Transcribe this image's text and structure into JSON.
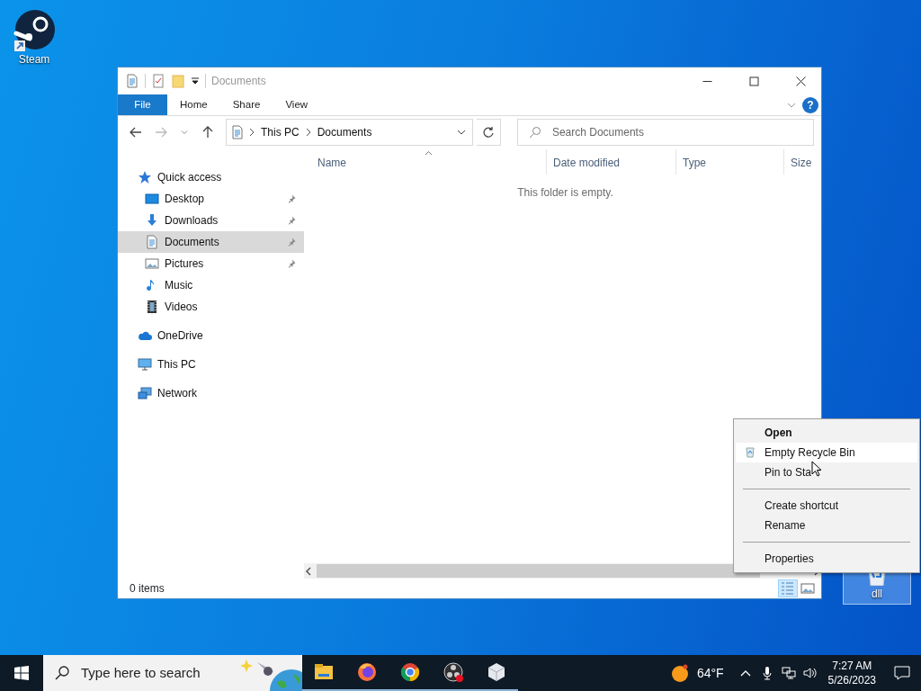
{
  "desktop_icons": [
    {
      "kind": "steam",
      "label": "Steam",
      "selected": false
    },
    {
      "kind": "recycle_bin",
      "label": "dll",
      "selected": true
    }
  ],
  "window": {
    "title": "Documents",
    "ribbon_tabs": [
      {
        "label": "File",
        "kind": "file"
      },
      {
        "label": "Home",
        "kind": "tab"
      },
      {
        "label": "Share",
        "kind": "tab"
      },
      {
        "label": "View",
        "kind": "tab"
      }
    ],
    "help_button": "?",
    "breadcrumbs": [
      "This PC",
      "Documents"
    ],
    "search": {
      "placeholder": "Search Documents"
    },
    "navigation": [
      {
        "label": "Quick access",
        "kind": "star",
        "selected": false,
        "children": [
          {
            "label": "Desktop",
            "kind": "desktop",
            "pinned": true,
            "selected": false
          },
          {
            "label": "Downloads",
            "kind": "download",
            "pinned": true,
            "selected": false
          },
          {
            "label": "Documents",
            "kind": "document",
            "pinned": true,
            "selected": true
          },
          {
            "label": "Pictures",
            "kind": "pictures",
            "pinned": true,
            "selected": false
          },
          {
            "label": "Music",
            "kind": "music",
            "pinned": false,
            "selected": false
          },
          {
            "label": "Videos",
            "kind": "videos",
            "pinned": false,
            "selected": false
          }
        ]
      },
      {
        "label": "OneDrive",
        "kind": "cloud",
        "selected": false
      },
      {
        "label": "This PC",
        "kind": "monitor",
        "selected": false
      },
      {
        "label": "Network",
        "kind": "network",
        "selected": false
      }
    ],
    "columns": [
      {
        "label": "Name",
        "sorted": true
      },
      {
        "label": "Date modified",
        "sorted": false
      },
      {
        "label": "Type",
        "sorted": false
      },
      {
        "label": "Size",
        "sorted": false
      }
    ],
    "empty_message": "This folder is empty.",
    "status_bar": {
      "item_count": "0 items",
      "view_buttons": [
        {
          "kind": "details",
          "selected": true
        },
        {
          "kind": "large_icons",
          "selected": false
        }
      ]
    }
  },
  "context_menu": [
    {
      "kind": "item",
      "label": "Open",
      "default": true,
      "highlighted": false
    },
    {
      "kind": "recycle_item",
      "label": "Empty Recycle Bin",
      "default": false,
      "highlighted": true
    },
    {
      "kind": "item",
      "label": "Pin to Sta",
      "default": false,
      "highlighted": false
    },
    {
      "kind": "separator"
    },
    {
      "kind": "item",
      "label": "Create shortcut",
      "default": false,
      "highlighted": false
    },
    {
      "kind": "item",
      "label": "Rename",
      "default": false,
      "highlighted": false
    },
    {
      "kind": "separator"
    },
    {
      "kind": "item",
      "label": "Properties",
      "default": false,
      "highlighted": false
    }
  ],
  "taskbar": {
    "search_placeholder": "Type here to search",
    "apps": [
      {
        "kind": "file_explorer",
        "running": true
      },
      {
        "kind": "firefox",
        "running": true
      },
      {
        "kind": "chrome",
        "running": true
      },
      {
        "kind": "obs",
        "running": true
      },
      {
        "kind": "cube",
        "running": true
      }
    ],
    "weather": "64°F",
    "time": "7:27 AM",
    "date": "5/26/2023"
  }
}
